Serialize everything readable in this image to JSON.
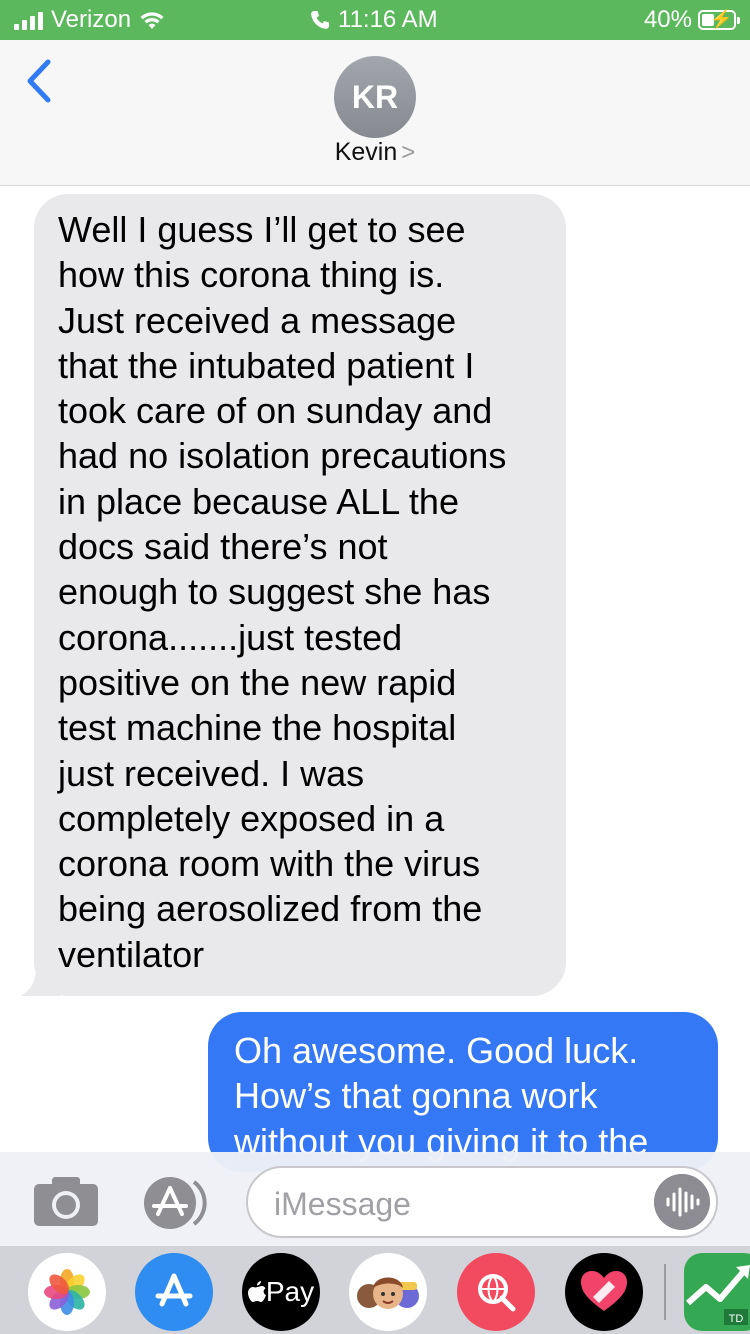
{
  "status_bar": {
    "carrier": "Verizon",
    "time": "11:16 AM",
    "battery_percent": "40%",
    "battery_level": 0.4,
    "signal_bars": 4,
    "signal_bars_total": 4,
    "bar_color": "#5cb85c"
  },
  "header": {
    "avatar_initials": "KR",
    "contact_name": "Kevin",
    "contact_chevron": ">"
  },
  "messages": [
    {
      "direction": "incoming",
      "lines": [
        "Well I guess I’ll get to see",
        "how this corona thing is.",
        "Just received a message",
        "that the intubated patient I",
        "took care of on sunday and",
        "had no isolation precautions",
        "in place because ALL the",
        "docs said there’s not",
        "enough to suggest she has",
        "corona.......just tested",
        "positive on the new rapid",
        "test machine the hospital",
        "just received. I was",
        "completely exposed in a",
        "corona room with the virus",
        "being aerosolized from the",
        "ventilator"
      ]
    },
    {
      "direction": "outgoing",
      "lines": [
        "Oh awesome. Good luck.",
        "How’s that gonna work",
        "without you giving it to the"
      ]
    }
  ],
  "input": {
    "placeholder": "iMessage"
  },
  "apps": {
    "apple_pay_label": "Pay"
  },
  "colors": {
    "accent_blue": "#3478f6",
    "incoming_bubble": "#e9e9eb"
  }
}
